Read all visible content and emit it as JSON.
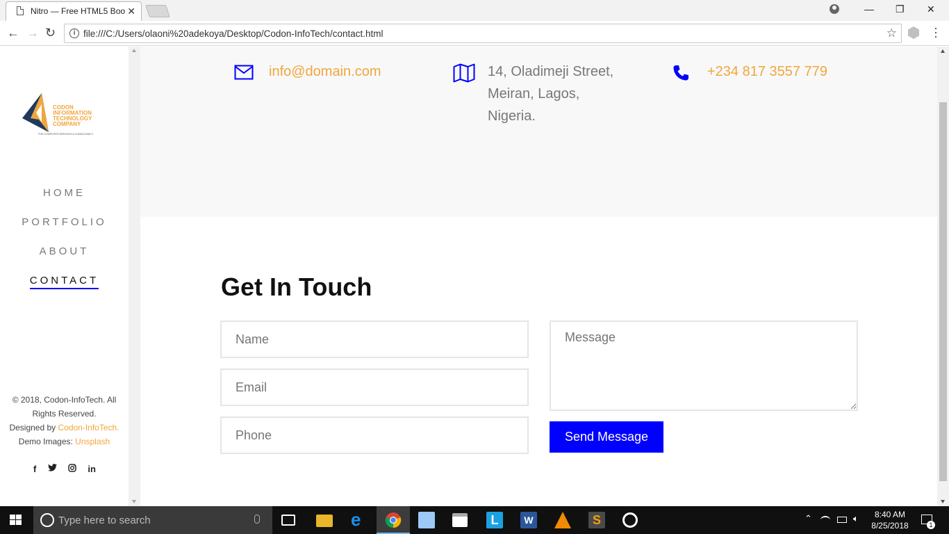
{
  "browser": {
    "tab_title": "Nitro — Free HTML5 Boo",
    "url": "file:///C:/Users/olaoni%20adekoya/Desktop/Codon-InfoTech/contact.html",
    "icons": [
      "document-icon",
      "close-tab-icon",
      "back-arrow-icon",
      "forward-arrow-icon",
      "reload-icon",
      "info-icon",
      "star-icon",
      "extension-icon",
      "menu-icon",
      "user-icon",
      "minimize-icon",
      "restore-icon",
      "window-close-icon"
    ]
  },
  "logo": {
    "lines": [
      "CODON",
      "INFORMATION",
      "TECHNOLOGY",
      "COMPANY"
    ],
    "tagline": "FOR COMPUTER SERVICES & CONSULTANCY"
  },
  "nav": {
    "items": [
      {
        "label": "HOME",
        "active": false
      },
      {
        "label": "PORTFOLIO",
        "active": false
      },
      {
        "label": "ABOUT",
        "active": false
      },
      {
        "label": "CONTACT",
        "active": true
      }
    ]
  },
  "footer": {
    "copyright": "© 2018, Codon-InfoTech. All Rights Reserved.",
    "designed_by_prefix": "Designed by ",
    "designed_by_link": "Codon-InfoTech.",
    "demo_images_prefix": "Demo Images: ",
    "demo_images_link": "Unsplash",
    "social_icons": [
      "facebook-icon",
      "twitter-icon",
      "instagram-icon",
      "linkedin-icon"
    ],
    "social_glyphs": [
      "f",
      "🐦",
      "◎",
      "in"
    ]
  },
  "contact_info": {
    "email": "info@domain.com",
    "address_lines": [
      "14, Oladimeji Street,",
      "Meiran, Lagos,",
      "Nigeria."
    ],
    "phone": "+234 817 3557 779"
  },
  "form": {
    "title": "Get In Touch",
    "name_placeholder": "Name",
    "email_placeholder": "Email",
    "phone_placeholder": "Phone",
    "message_placeholder": "Message",
    "submit_label": "Send Message"
  },
  "colors": {
    "accent_orange": "#f0a63c",
    "accent_blue": "#0000ff",
    "strip_bg": "#f8f8f8"
  },
  "taskbar": {
    "search_placeholder": "Type here to search",
    "time": "8:40 AM",
    "date": "8/25/2018",
    "notification_count": "1",
    "apps": [
      "task-view-icon",
      "file-explorer-icon",
      "edge-icon",
      "chrome-icon",
      "3d-box-icon",
      "store-icon",
      "l-app-icon",
      "word-icon",
      "vlc-icon",
      "sublime-icon",
      "target-app-icon"
    ]
  }
}
